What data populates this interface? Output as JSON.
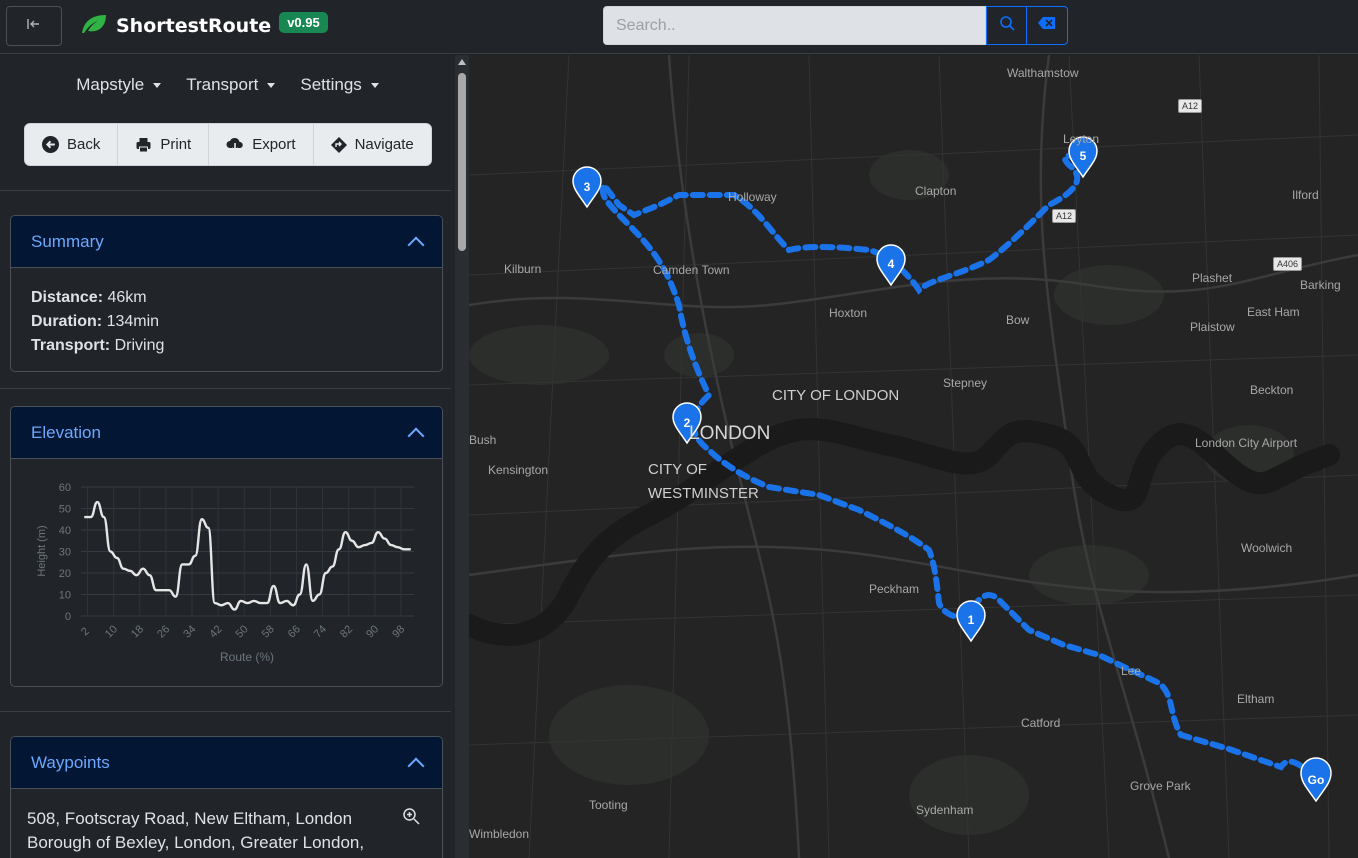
{
  "app": {
    "name": "ShortestRoute",
    "version": "v0.95",
    "collapse_icon": "collapse-sidebar-icon"
  },
  "search": {
    "placeholder": "Search..",
    "value": ""
  },
  "menus": [
    {
      "label": "Mapstyle"
    },
    {
      "label": "Transport"
    },
    {
      "label": "Settings"
    }
  ],
  "actions": {
    "back": "Back",
    "print": "Print",
    "export": "Export",
    "navigate": "Navigate"
  },
  "summary": {
    "title": "Summary",
    "distance_label": "Distance:",
    "distance": "46km",
    "duration_label": "Duration:",
    "duration": "134min",
    "transport_label": "Transport:",
    "transport": "Driving"
  },
  "elevation": {
    "title": "Elevation"
  },
  "chart_data": {
    "type": "line",
    "title": "",
    "xlabel": "Route (%)",
    "ylabel": "Height (m)",
    "ylim": [
      0,
      60
    ],
    "yticks": [
      0,
      10,
      20,
      30,
      40,
      50,
      60
    ],
    "xticks": [
      2,
      10,
      18,
      26,
      34,
      42,
      50,
      58,
      66,
      74,
      82,
      90,
      98
    ],
    "grid": true,
    "x": [
      1,
      3,
      5,
      7,
      9,
      11,
      13,
      15,
      17,
      19,
      21,
      23,
      25,
      27,
      29,
      31,
      33,
      35,
      37,
      39,
      41,
      43,
      45,
      47,
      49,
      51,
      53,
      55,
      57,
      59,
      61,
      63,
      65,
      67,
      69,
      71,
      73,
      75,
      77,
      79,
      81,
      83,
      85,
      87,
      89,
      91,
      93,
      95,
      97,
      99,
      101
    ],
    "values": [
      46,
      46,
      53,
      46,
      30,
      27,
      22,
      21,
      19,
      22,
      19,
      12,
      12,
      12,
      9,
      24,
      24,
      28,
      45,
      41,
      6,
      5,
      6,
      3,
      7,
      6,
      7,
      6,
      6,
      14,
      6,
      7,
      5,
      10,
      24,
      7,
      10,
      20,
      23,
      31,
      39,
      35,
      32,
      33,
      34,
      39,
      36,
      33,
      32,
      31,
      31
    ],
    "series_color": "#e6e6e6"
  },
  "waypoints": {
    "title": "Waypoints",
    "items": [
      {
        "address": "508, Footscray Road, New Eltham, London Borough of Bexley, London, Greater London,"
      }
    ]
  },
  "map": {
    "places": [
      {
        "name": "Walthamstow"
      },
      {
        "name": "Leyton"
      },
      {
        "name": "Ilford"
      },
      {
        "name": "Holloway"
      },
      {
        "name": "Clapton"
      },
      {
        "name": "Kilburn"
      },
      {
        "name": "Camden Town"
      },
      {
        "name": "Plashet"
      },
      {
        "name": "Barking"
      },
      {
        "name": "Hoxton"
      },
      {
        "name": "Bow"
      },
      {
        "name": "Plaistow"
      },
      {
        "name": "East Ham"
      },
      {
        "name": "Stepney"
      },
      {
        "name": "CITY OF LONDON"
      },
      {
        "name": "Beckton"
      },
      {
        "name": "LONDON"
      },
      {
        "name": "Bush"
      },
      {
        "name": "London City Airport"
      },
      {
        "name": "Kensington"
      },
      {
        "name": "CITY OF"
      },
      {
        "name": "WESTMINSTER"
      },
      {
        "name": "Woolwich"
      },
      {
        "name": "Peckham"
      },
      {
        "name": "Lee"
      },
      {
        "name": "Eltham"
      },
      {
        "name": "Catford"
      },
      {
        "name": "Grove Park"
      },
      {
        "name": "Tooting"
      },
      {
        "name": "Sydenham"
      },
      {
        "name": "Wimbledon"
      }
    ],
    "road_shields": [
      "A12",
      "A12",
      "A406"
    ],
    "markers": [
      "1",
      "2",
      "3",
      "4",
      "5",
      "Go"
    ],
    "route_color": "#1a73e8"
  }
}
